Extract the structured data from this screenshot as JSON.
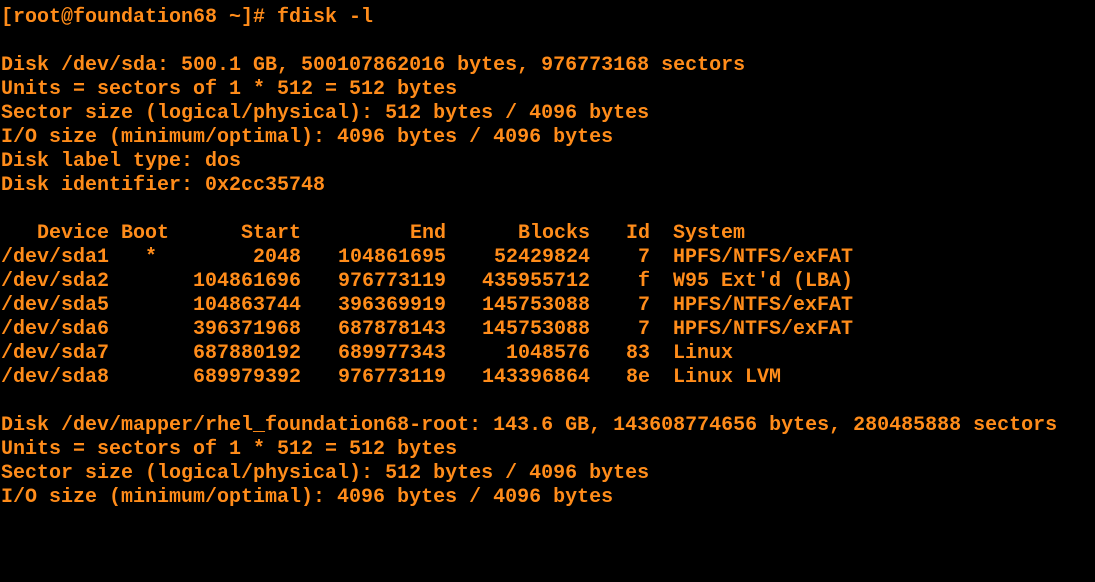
{
  "terminal": {
    "fg_color": "#ff8c1a",
    "bg_color": "#000000",
    "prompt": "[root@foundation68 ~]# fdisk -l",
    "disk1": {
      "l1": "Disk /dev/sda: 500.1 GB, 500107862016 bytes, 976773168 sectors",
      "l2": "Units = sectors of 1 * 512 = 512 bytes",
      "l3": "Sector size (logical/physical): 512 bytes / 4096 bytes",
      "l4": "I/O size (minimum/optimal): 4096 bytes / 4096 bytes",
      "l5": "Disk label type: dos",
      "l6": "Disk identifier: 0x2cc35748"
    },
    "table": {
      "headers": {
        "device": "Device",
        "boot": "Boot",
        "start": "Start",
        "end": "End",
        "blocks": "Blocks",
        "id": "Id",
        "system": "System"
      },
      "rows": [
        {
          "device": "/dev/sda1",
          "boot": "*",
          "start": "2048",
          "end": "104861695",
          "blocks": "52429824",
          "id": "7",
          "system": "HPFS/NTFS/exFAT"
        },
        {
          "device": "/dev/sda2",
          "boot": "",
          "start": "104861696",
          "end": "976773119",
          "blocks": "435955712",
          "id": "f",
          "system": "W95 Ext'd (LBA)"
        },
        {
          "device": "/dev/sda5",
          "boot": "",
          "start": "104863744",
          "end": "396369919",
          "blocks": "145753088",
          "id": "7",
          "system": "HPFS/NTFS/exFAT"
        },
        {
          "device": "/dev/sda6",
          "boot": "",
          "start": "396371968",
          "end": "687878143",
          "blocks": "145753088",
          "id": "7",
          "system": "HPFS/NTFS/exFAT"
        },
        {
          "device": "/dev/sda7",
          "boot": "",
          "start": "687880192",
          "end": "689977343",
          "blocks": "1048576",
          "id": "83",
          "system": "Linux"
        },
        {
          "device": "/dev/sda8",
          "boot": "",
          "start": "689979392",
          "end": "976773119",
          "blocks": "143396864",
          "id": "8e",
          "system": "Linux LVM"
        }
      ]
    },
    "disk2": {
      "l1": "Disk /dev/mapper/rhel_foundation68-root: 143.6 GB, 143608774656 bytes, 280485888 sectors",
      "l2": "Units = sectors of 1 * 512 = 512 bytes",
      "l3": "Sector size (logical/physical): 512 bytes / 4096 bytes",
      "l4": "I/O size (minimum/optimal): 4096 bytes / 4096 bytes"
    }
  }
}
